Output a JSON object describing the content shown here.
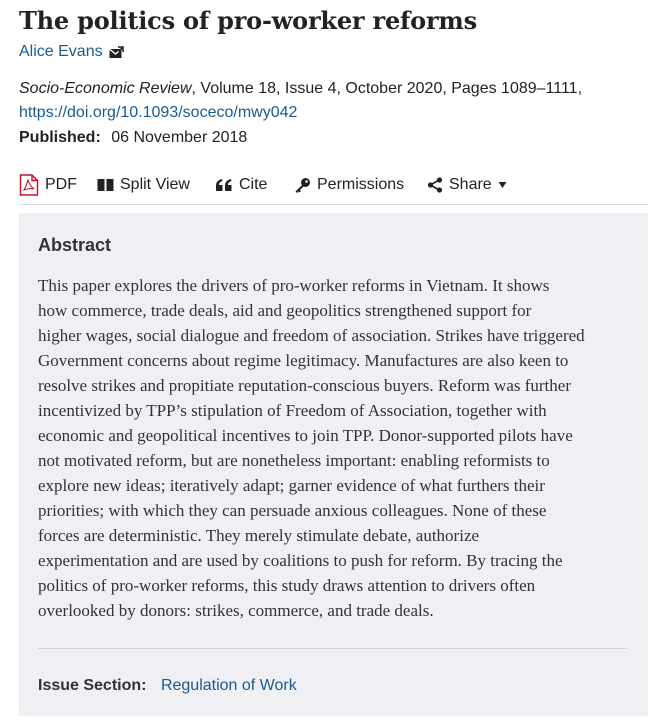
{
  "article": {
    "title": "The politics of pro-worker reforms",
    "author": "Alice Evans",
    "journal": "Socio-Economic Review",
    "citation_rest": ", Volume 18, Issue 4, October 2020, Pages 1089–1111,",
    "doi": "https://doi.org/10.1093/soceco/mwy042",
    "published_label": "Published:",
    "published_date": "06 November 2018"
  },
  "toolbar": {
    "pdf": "PDF",
    "split_view": "Split View",
    "cite": "Cite",
    "permissions": "Permissions",
    "share": "Share"
  },
  "abstract": {
    "heading": "Abstract",
    "lines": [
      "This paper explores the drivers of pro-worker reforms in Vietnam. It shows",
      "how commerce, trade deals, aid and geopolitics strengthened support for",
      "higher wages, social dialogue and freedom of association. Strikes have triggered",
      "Government concerns about regime legitimacy. Manufactures are also keen to",
      "resolve strikes and propitiate reputation-conscious buyers. Reform was further",
      "incentivized by TPP’s stipulation of Freedom of Association, together with",
      "economic and geopolitical incentives to join TPP. Donor-supported pilots have",
      "not motivated reform, but are nonetheless important: enabling reformists to",
      "explore new ideas; iteratively adapt; garner evidence of what furthers their",
      "priorities; with which they can persuade anxious colleagues. None of these",
      "forces are deterministic. They merely stimulate debate, authorize",
      "experimentation and are used by coalitions to push for reform. By tracing the",
      "politics of pro-worker reforms, this study draws attention to drivers often",
      "overlooked by donors: strikes, commerce, and trade deals."
    ],
    "issue_label": "Issue Section:",
    "issue_value": "Regulation of Work"
  },
  "colors": {
    "link": "#1a5b8f",
    "pdf_red": "#c8102e",
    "abstract_bg": "#eef0f3"
  },
  "icons": {
    "mail": "envelope-icon",
    "pdf": "pdf-file-icon",
    "split_view": "split-view-icon",
    "cite": "quote-icon",
    "permissions": "key-icon",
    "share": "share-icon",
    "share_caret": "caret-down-icon"
  }
}
